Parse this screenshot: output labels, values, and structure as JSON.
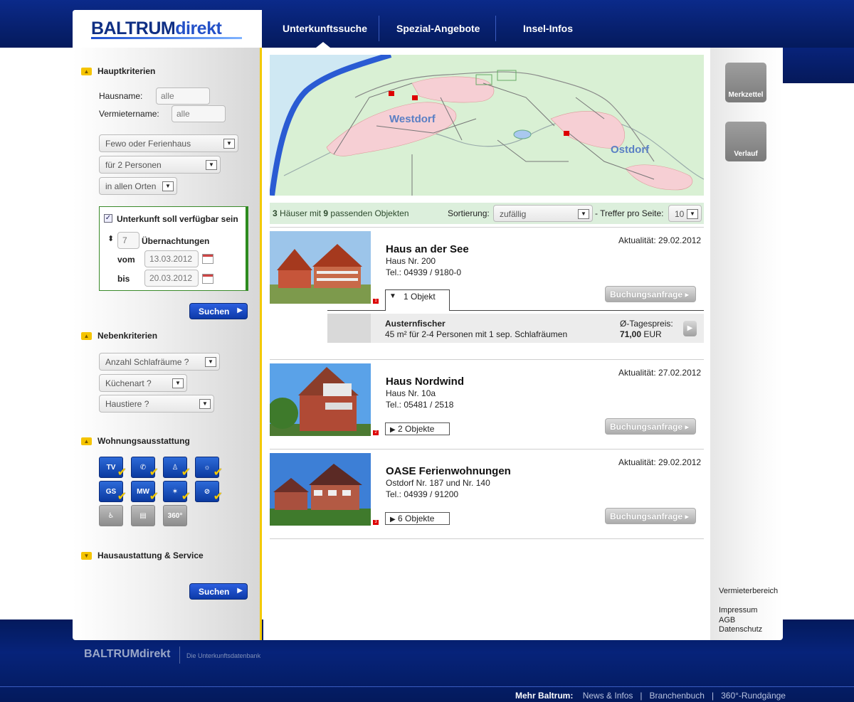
{
  "brand": {
    "name_a": "BALTRUM",
    "name_b": "direkt",
    "footer_tagline": "Die Unterkunftsdatenbank"
  },
  "nav": [
    "Unterkunftssuche",
    "Spezial-Angebote",
    "Insel-Infos"
  ],
  "sidebar": {
    "haupt": {
      "title": "Hauptkriterien",
      "hausname_label": "Hausname:",
      "hausname_value": "alle",
      "vermieter_label": "Vermietername:",
      "vermieter_value": "alle",
      "type_select": "Fewo oder Ferienhaus",
      "persons_select": "für 2 Personen",
      "place_select": "in allen Orten",
      "avail_label": "Unterkunft soll verfügbar sein",
      "nights_value": "7",
      "nights_label": "Übernachtungen",
      "from_label": "vom",
      "from_value": "13.03.2012",
      "to_label": "bis",
      "to_value": "20.03.2012",
      "search_btn": "Suchen"
    },
    "neben": {
      "title": "Nebenkriterien",
      "s1": "Anzahl Schlafräume ?",
      "s2": "Küchenart ?",
      "s3": "Haustiere ?"
    },
    "ausstattung": {
      "title": "Wohnungsausstattung",
      "icons": [
        "TV",
        "GS",
        "MW",
        "360°"
      ]
    },
    "haus": {
      "title": "Hausaustattung & Service",
      "search_btn": "Suchen"
    }
  },
  "map": {
    "place1": "Westdorf",
    "place2": "Ostdorf"
  },
  "results": {
    "count_houses": "3",
    "text1": "Häuser mit",
    "count_objects": "9",
    "text2": "passenden Objekten",
    "sort_label": "Sortierung:",
    "sort_value": "zufällig",
    "per_page_label": "- Treffer pro Seite:",
    "per_page_value": "10"
  },
  "houses": [
    {
      "name": "Haus an der See",
      "addr": "Haus Nr. 200",
      "tel": "Tel.: 04939 / 9180-0",
      "akt": "Aktualität: 29.02.2012",
      "objects": "1 Objekt",
      "btn": "Buchungsanfrage",
      "tag": "1"
    },
    {
      "name": "Haus Nordwind",
      "addr": "Haus Nr. 10a",
      "tel": "Tel.: 05481 / 2518",
      "akt": "Aktualität: 27.02.2012",
      "objects": "2 Objekte",
      "btn": "Buchungsanfrage",
      "tag": "2"
    },
    {
      "name": "OASE Ferienwohnungen",
      "addr": "Ostdorf Nr. 187 und Nr. 140",
      "tel": "Tel.: 04939 / 91200",
      "akt": "Aktualität: 29.02.2012",
      "objects": "6 Objekte",
      "btn": "Buchungsanfrage",
      "tag": "3"
    }
  ],
  "object_row": {
    "name": "Austernfischer",
    "desc": "45 m² für 2-4 Personen mit 1 sep. Schlafräumen",
    "price_label": "Ø-Tagespreis:",
    "price_value": "71,00",
    "price_currency": "EUR"
  },
  "right": {
    "merkzettel": "Merkzettel",
    "verlauf": "Verlauf",
    "vermieter": "Vermieterbereich",
    "impressum": "Impressum",
    "agb": "AGB",
    "datenschutz": "Datenschutz"
  },
  "footer": {
    "label": "Mehr Baltrum:",
    "links": [
      "News & Infos",
      "Branchenbuch",
      "360°-Rundgänge"
    ],
    "sep": "|"
  },
  "colors": {
    "navy": "#07206e",
    "accent_yellow": "#f3c900",
    "result_green": "#dcefdc"
  }
}
